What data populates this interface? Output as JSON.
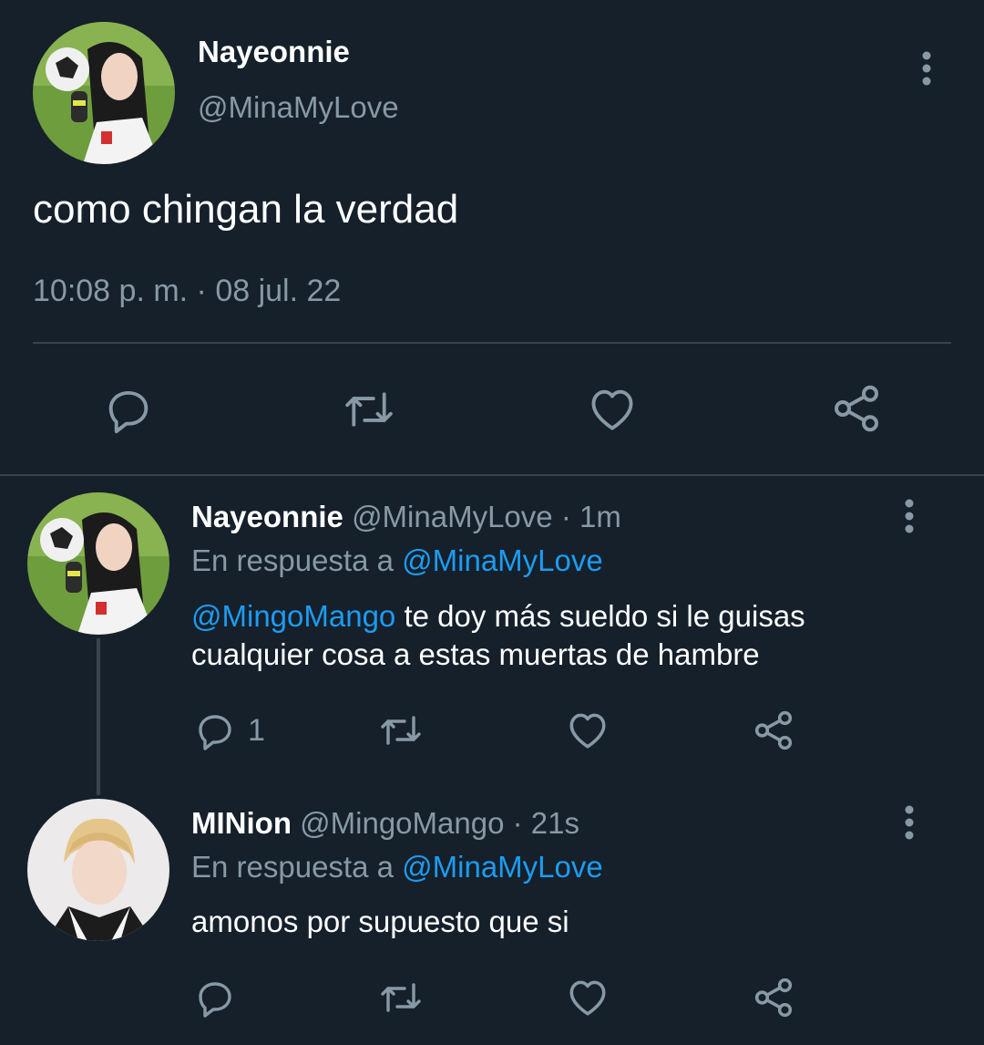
{
  "main_tweet": {
    "display_name": "Nayeonnie",
    "handle": "@MinaMyLove",
    "text": "como chingan la verdad",
    "timestamp": "10:08 p. m. · 08 jul. 22"
  },
  "replies": [
    {
      "display_name": "Nayeonnie",
      "handle": "@MinaMyLove",
      "time": "· 1m",
      "reply_prefix": "En respuesta a",
      "reply_to": "@MinaMyLove",
      "mention": "@MingoMango",
      "text": " te doy más sueldo si le guisas cualquier cosa a estas muertas de hambre",
      "reply_count": "1"
    },
    {
      "display_name": "MINion",
      "handle": "@MingoMango",
      "time": "· 21s",
      "reply_prefix": "En respuesta a",
      "reply_to": "@MinaMyLove",
      "text": "amonos por supuesto que si"
    }
  ],
  "icons": {
    "reply": "reply-icon",
    "retweet": "retweet-icon",
    "like": "heart-icon",
    "share": "share-icon",
    "more": "more-vertical-icon"
  },
  "colors": {
    "background": "#15202b",
    "muted": "#8899a6",
    "link": "#1d9bf0",
    "divider": "#38444d"
  }
}
